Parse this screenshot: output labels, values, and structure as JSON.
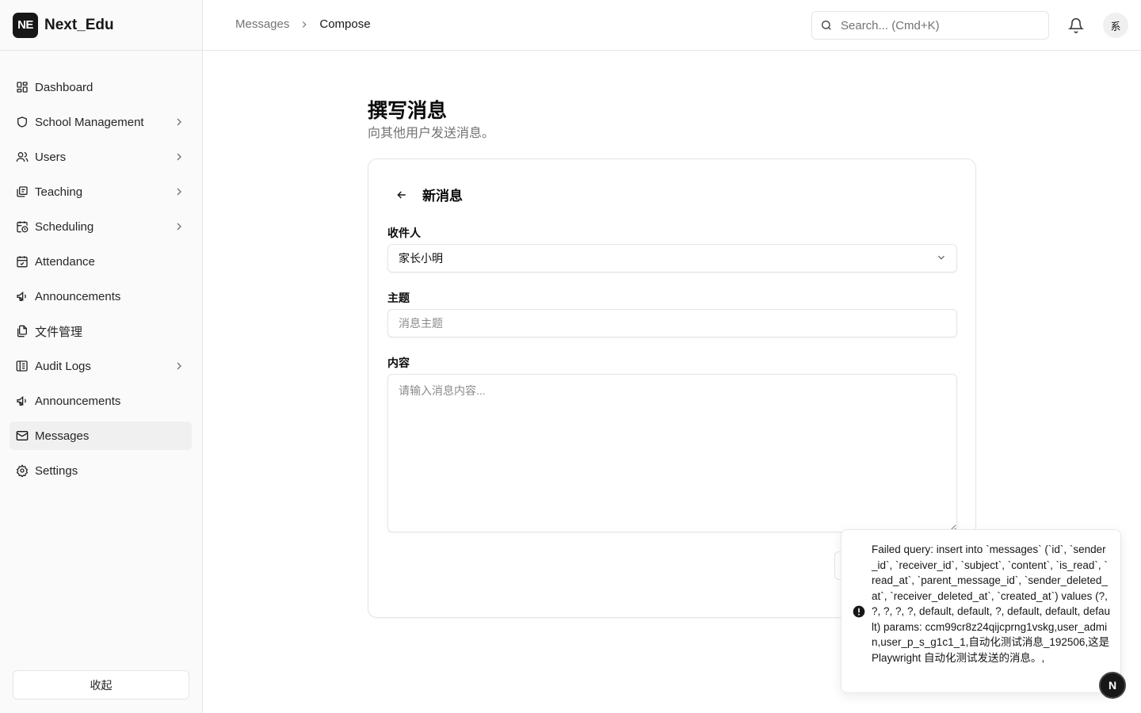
{
  "brand": {
    "logo_text": "NE",
    "name": "Next_Edu"
  },
  "sidebar": {
    "items": [
      {
        "label": "Dashboard",
        "icon": "dashboard-icon",
        "has_children": false,
        "active": false
      },
      {
        "label": "School Management",
        "icon": "shield-icon",
        "has_children": true,
        "active": false
      },
      {
        "label": "Users",
        "icon": "users-icon",
        "has_children": true,
        "active": false
      },
      {
        "label": "Teaching",
        "icon": "book-icon",
        "has_children": true,
        "active": false
      },
      {
        "label": "Scheduling",
        "icon": "calendar-clock-icon",
        "has_children": true,
        "active": false
      },
      {
        "label": "Attendance",
        "icon": "calendar-check-icon",
        "has_children": false,
        "active": false
      },
      {
        "label": "Announcements",
        "icon": "megaphone-icon",
        "has_children": false,
        "active": false
      },
      {
        "label": "文件管理",
        "icon": "files-icon",
        "has_children": false,
        "active": false
      },
      {
        "label": "Audit Logs",
        "icon": "audit-log-icon",
        "has_children": true,
        "active": false
      },
      {
        "label": "Announcements",
        "icon": "megaphone-icon",
        "has_children": false,
        "active": false
      },
      {
        "label": "Messages",
        "icon": "mail-icon",
        "has_children": false,
        "active": true
      },
      {
        "label": "Settings",
        "icon": "gear-icon",
        "has_children": false,
        "active": false
      }
    ],
    "collapse_label": "收起"
  },
  "header": {
    "breadcrumb": [
      "Messages",
      "Compose"
    ],
    "search_placeholder": "Search... (Cmd+K)",
    "avatar_text": "系"
  },
  "main": {
    "title": "撰写消息",
    "subtitle": "向其他用户发送消息。",
    "card": {
      "title": "新消息",
      "recipient_label": "收件人",
      "recipient_value": "家长小明",
      "subject_label": "主题",
      "subject_placeholder": "消息主题",
      "content_label": "内容",
      "content_placeholder": "请输入消息内容..."
    }
  },
  "toast": {
    "type": "error",
    "message": "Failed query: insert into `messages` (`id`, `sender_id`, `receiver_id`, `subject`, `content`, `is_read`, `read_at`, `parent_message_id`, `sender_deleted_at`, `receiver_deleted_at`, `created_at`) values (?, ?, ?, ?, ?, default, default, ?, default, default, default) params: ccm99cr8z24qijcprng1vskg,user_admin,user_p_s_g1c1_1,自动化测试消息_192506,这是 Playwright 自动化测试发送的消息。,"
  },
  "fab_text": "N"
}
